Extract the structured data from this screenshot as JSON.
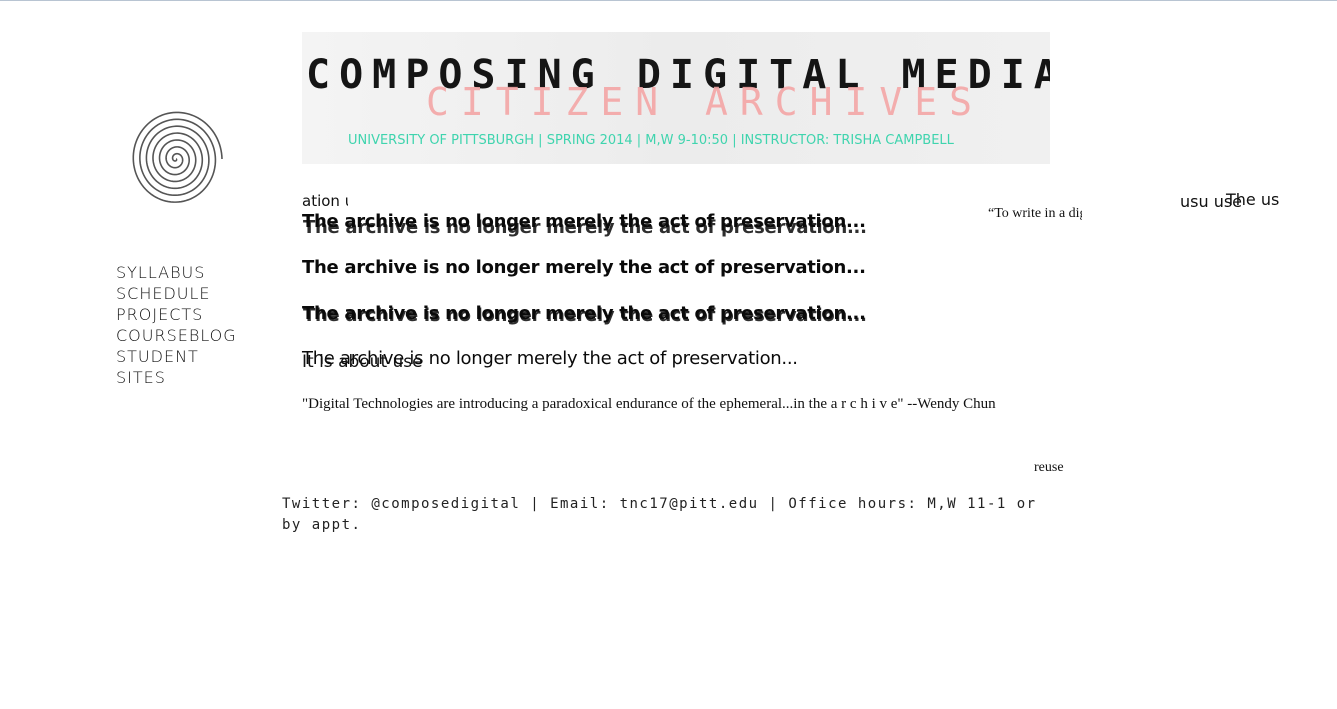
{
  "banner": {
    "title": "COMPOSING DIGITAL MEDIA:",
    "subtitle": "CITIZEN ARCHIVES",
    "info": "UNIVERSITY OF PITTSBURGH | SPRING 2014 | M,W 9-10:50 | INSTRUCTOR: TRISHA CAMPBELL",
    "title_color": "#151515",
    "subtitle_color": "#f4a6a6",
    "info_color": "#3fd4ae"
  },
  "logo": {
    "icon": "spiral-icon"
  },
  "nav": {
    "items": [
      "SYLLABUS",
      "SCHEDULE",
      "PROJECTS",
      "COURSEBLOG",
      "STUDENT",
      "SITES"
    ]
  },
  "fragments": {
    "top_left": "ation use",
    "quote_start": "“To write in a digital",
    "top_right_a": "usu use",
    "top_right_b": "The us"
  },
  "headlines": {
    "line1": "The archive is no longer merely the act of preservation...",
    "line2": "The archive is no longer merely the act of preservation...",
    "line3": "The archive is no longer merely the act of preservation...",
    "line4": "The archive is no longer merely the act of preservation...",
    "overlay_use": "use",
    "about_use": "It is about use"
  },
  "quote": "\"Digital Technologies are introducing a paradoxical endurance of the ephemeral...in the a r c h i v e\" --Wendy Chun",
  "reuse": "reuse",
  "footer": "Twitter: @composedigital | Email: tnc17@pitt.edu | Office hours: M,W 11-1 or by appt."
}
